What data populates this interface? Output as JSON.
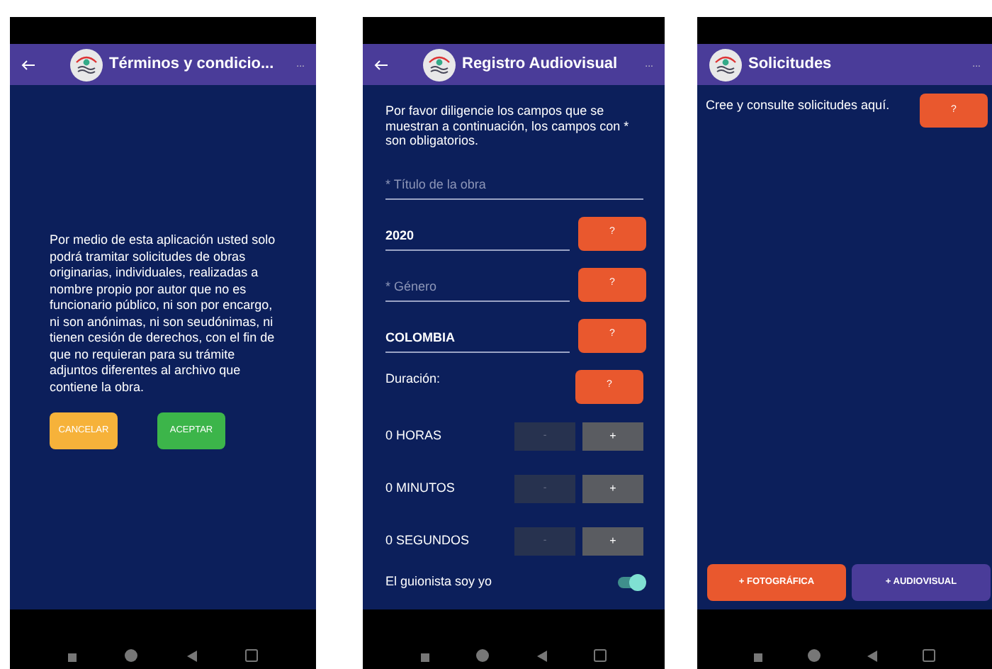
{
  "screens": [
    {
      "kind": "terms",
      "title": "Términos y condicio...",
      "back": true,
      "menu": "...",
      "body": "Por medio de esta aplicación usted solo podrá tramitar solicitudes de obras originarias, individuales, realizadas a nombre propio por autor que no es funcionario público, ni son por encargo, ni son anónimas, ni son seudónimas, ni tienen cesión de derechos, con el fin de que no requieran para su trámite adjuntos diferentes al archivo que contiene la obra.",
      "buttons": [
        {
          "label": "CANCELAR",
          "color": "#f6b23a"
        },
        {
          "label": "ACEPTAR",
          "color": "#3cb54a"
        }
      ]
    },
    {
      "kind": "form",
      "title": "Registro Audiovisual",
      "back": true,
      "menu": "...",
      "intro": "Por favor diligencie los campos que se muestran a continuación, los campos con * son obligatorios.",
      "rows": [
        {
          "kind": "field",
          "placeholder": "* Título de la obra"
        },
        {
          "kind": "field",
          "value": "2020",
          "help": "?"
        },
        {
          "kind": "field",
          "placeholder": "* Género",
          "help": "?"
        },
        {
          "kind": "field",
          "value": "COLOMBIA",
          "help": "?"
        },
        {
          "kind": "label",
          "label": "Duración:",
          "help": "?"
        },
        {
          "kind": "counter",
          "label": "0 HORAS",
          "minus": "-",
          "plus": "+"
        },
        {
          "kind": "counter",
          "label": "0 MINUTOS",
          "minus": "-",
          "plus": "+"
        },
        {
          "kind": "counter",
          "label": "0 SEGUNDOS",
          "minus": "-",
          "plus": "+"
        },
        {
          "kind": "toggle",
          "label": "El guionista soy yo",
          "on": true
        }
      ]
    },
    {
      "kind": "list",
      "title": "Solicitudes",
      "back": false,
      "menu": "...",
      "intro": "Cree y consulte solicitudes aquí.",
      "help": "?",
      "buttons": [
        {
          "label": "+ FOTOGRÁFICA",
          "color": "#e9582e"
        },
        {
          "label": "+ AUDIOVISUAL",
          "color": "#4a3c99"
        }
      ]
    }
  ]
}
